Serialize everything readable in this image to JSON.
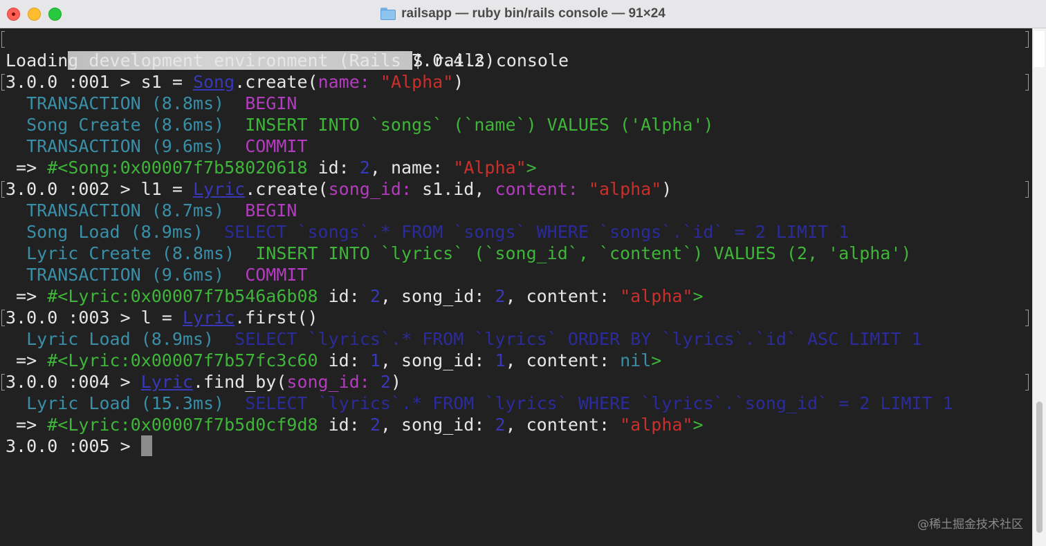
{
  "window": {
    "title": "railsapp — ruby bin/rails console — 91×24",
    "icon": "folder-icon"
  },
  "colors": {
    "prompt_text": "#e6e6e6",
    "log_label": "#3a8fa8",
    "sql_keyword": "#b33cbf",
    "sql_insert": "#3fb539",
    "string": "#c9302c",
    "select_query": "#2b2b9c",
    "number": "#3838b8"
  },
  "lines": {
    "l0": {
      "cmd": "$ rails console"
    },
    "l1": {
      "text": "Loading development environment (Rails 7.0.4.2)"
    },
    "l2": {
      "prompt": "3.0.0 :001 > ",
      "a": "s1 = ",
      "cls": "Song",
      "b": ".create(",
      "key": "name: ",
      "str": "\"Alpha\"",
      "c": ")"
    },
    "l3": {
      "label": "  TRANSACTION (8.8ms)  ",
      "sql": "BEGIN"
    },
    "l4": {
      "label": "  Song Create (8.6ms)  ",
      "sql": "INSERT INTO `songs` (`name`) VALUES ('Alpha')"
    },
    "l5": {
      "label": "  TRANSACTION (9.6ms)  ",
      "sql": "COMMIT"
    },
    "l6": {
      "arrow": " => ",
      "obj": "#<Song:0x00007f7b58020618",
      "k1": " id: ",
      "v1": "2",
      "k2": ", name: ",
      "str": "\"Alpha\"",
      "end": ">"
    },
    "l7": {
      "prompt": "3.0.0 :002 > ",
      "a": "l1 = ",
      "cls": "Lyric",
      "b": ".create(",
      "key1": "song_id: ",
      "mid": "s1.id, ",
      "key2": "content: ",
      "str": "\"alpha\"",
      "c": ")"
    },
    "l8": {
      "label": "  TRANSACTION (8.7ms)  ",
      "sql": "BEGIN"
    },
    "l9": {
      "label": "  Song Load (8.9ms)  ",
      "sql": "SELECT `songs`.* FROM `songs` WHERE `songs`.`id` = 2 LIMIT 1"
    },
    "l10": {
      "label": "  Lyric Create (8.8ms)  ",
      "sql": "INSERT INTO `lyrics` (`song_id`, `content`) VALUES (2, 'alpha')"
    },
    "l11": {
      "label": "  TRANSACTION (9.6ms)  ",
      "sql": "COMMIT"
    },
    "l12": {
      "arrow": " => ",
      "obj": "#<Lyric:0x00007f7b546a6b08",
      "k1": " id: ",
      "v1": "2",
      "k2": ", song_id: ",
      "v2": "2",
      "k3": ", content: ",
      "str": "\"alpha\"",
      "end": ">"
    },
    "l13": {
      "prompt": "3.0.0 :003 > ",
      "a": "l = ",
      "cls": "Lyric",
      "b": ".first()"
    },
    "l14": {
      "label": "  Lyric Load (8.9ms)  ",
      "sql": "SELECT `lyrics`.* FROM `lyrics` ORDER BY `lyrics`.`id` ASC LIMIT 1"
    },
    "l15": {
      "arrow": " => ",
      "obj": "#<Lyric:0x00007f7b57fc3c60",
      "k1": " id: ",
      "v1": "1",
      "k2": ", song_id: ",
      "v2": "1",
      "k3": ", content: ",
      "nil": "nil",
      "end": ">"
    },
    "l16": {
      "prompt": "3.0.0 :004 > ",
      "cls": "Lyric",
      "b": ".find_by(",
      "key": "song_id: ",
      "num": "2",
      "c": ")"
    },
    "l17": {
      "label": "  Lyric Load (15.3ms)  ",
      "sql": "SELECT `lyrics`.* FROM `lyrics` WHERE `lyrics`.`song_id` = 2 LIMIT 1"
    },
    "l18": {
      "arrow": " => ",
      "obj": "#<Lyric:0x00007f7b5d0cf9d8",
      "k1": " id: ",
      "v1": "2",
      "k2": ", song_id: ",
      "v2": "2",
      "k3": ", content: ",
      "str": "\"alpha\"",
      "end": ">"
    },
    "l19": {
      "prompt": "3.0.0 :005 > "
    }
  },
  "watermark": "@稀土掘金技术社区"
}
